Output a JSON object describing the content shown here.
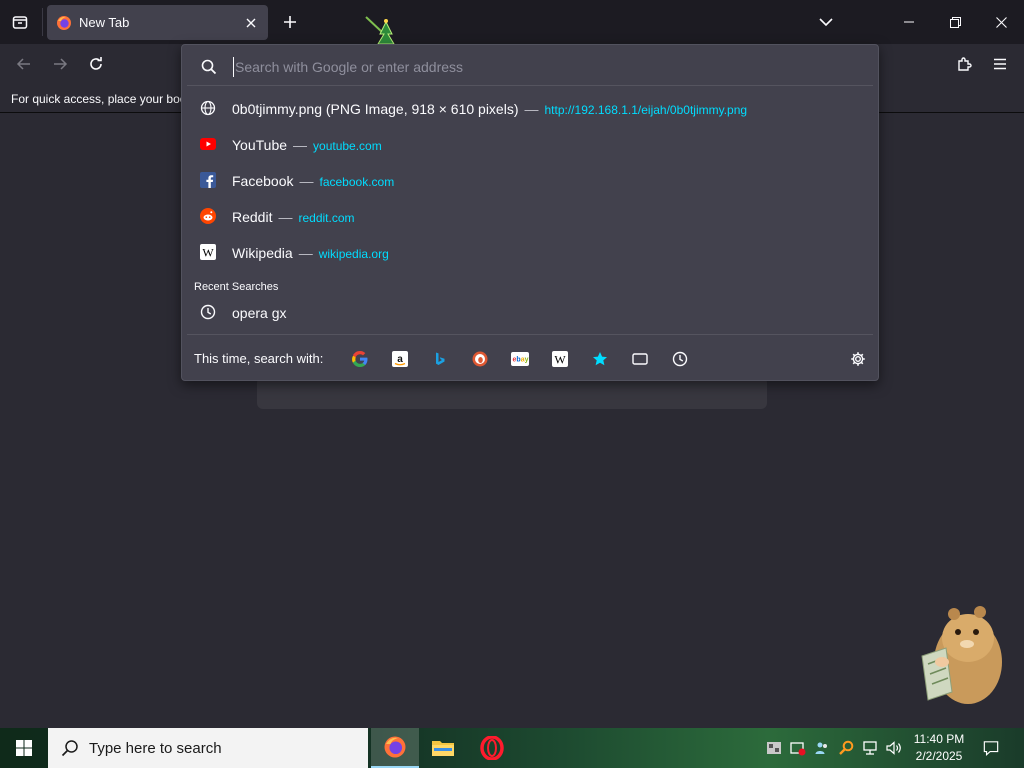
{
  "browser": {
    "tab": {
      "title": "New Tab"
    },
    "bookmarks_message": "For quick access, place your bookmarks here on the bookmarks toolbar."
  },
  "urlbar": {
    "placeholder": "Search with Google or enter address",
    "results": [
      {
        "icon": "globe-icon",
        "title": "0b0tjimmy.png (PNG Image, 918 × 610 pixels)",
        "url": "http://192.168.1.1/eijah/0b0tjimmy.png"
      },
      {
        "icon": "youtube-icon",
        "title": "YouTube",
        "url": "youtube.com"
      },
      {
        "icon": "facebook-icon",
        "title": "Facebook",
        "url": "facebook.com"
      },
      {
        "icon": "reddit-icon",
        "title": "Reddit",
        "url": "reddit.com"
      },
      {
        "icon": "wikipedia-icon",
        "title": "Wikipedia",
        "url": "wikipedia.org"
      }
    ],
    "separator": "—",
    "recent_searches_label": "Recent Searches",
    "recent_searches": [
      {
        "icon": "history-icon",
        "text": "opera gx"
      }
    ],
    "one_off_label": "This time, search with:",
    "one_off_engines": [
      "google-icon",
      "amazon-icon",
      "bing-icon",
      "duckduckgo-icon",
      "ebay-icon",
      "wikipedia-icon",
      "bookmarks-star-icon",
      "tabs-icon",
      "history-icon",
      "settings-gear-icon"
    ]
  },
  "taskbar": {
    "search_placeholder": "Type here to search",
    "time": "11:40 PM",
    "date": "2/2/2025"
  },
  "colors": {
    "accent_url": "#00ddff",
    "popup_bg": "#42414d",
    "chrome_bg": "#1c1b22",
    "content_bg": "#2b2a33"
  }
}
